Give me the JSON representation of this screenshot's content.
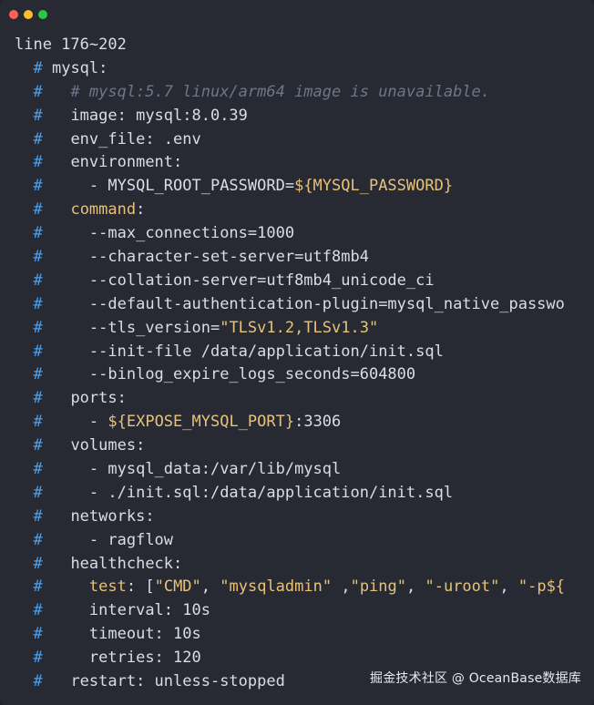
{
  "window": {
    "controls": [
      {
        "name": "close",
        "color": "#ff5f57"
      },
      {
        "name": "minimize",
        "color": "#febc2e"
      },
      {
        "name": "maximize",
        "color": "#28c840"
      }
    ]
  },
  "code": {
    "lines": [
      [
        {
          "t": "line 176~202",
          "c": "plain"
        }
      ],
      [
        {
          "t": "  ",
          "c": "plain"
        },
        {
          "t": "#",
          "c": "hash"
        },
        {
          "t": " mysql:",
          "c": "plain"
        }
      ],
      [
        {
          "t": "  ",
          "c": "plain"
        },
        {
          "t": "#",
          "c": "hash"
        },
        {
          "t": "   # mysql:5.7 linux/arm64 image is unavailable.",
          "c": "comment"
        }
      ],
      [
        {
          "t": "  ",
          "c": "plain"
        },
        {
          "t": "#",
          "c": "hash"
        },
        {
          "t": "   image: mysql:8.0.39",
          "c": "plain"
        }
      ],
      [
        {
          "t": "  ",
          "c": "plain"
        },
        {
          "t": "#",
          "c": "hash"
        },
        {
          "t": "   env_file: .env",
          "c": "plain"
        }
      ],
      [
        {
          "t": "  ",
          "c": "plain"
        },
        {
          "t": "#",
          "c": "hash"
        },
        {
          "t": "   environment:",
          "c": "plain"
        }
      ],
      [
        {
          "t": "  ",
          "c": "plain"
        },
        {
          "t": "#",
          "c": "hash"
        },
        {
          "t": "     - MYSQL_ROOT_PASSWORD=",
          "c": "plain"
        },
        {
          "t": "${MYSQL_PASSWORD}",
          "c": "str"
        }
      ],
      [
        {
          "t": "  ",
          "c": "plain"
        },
        {
          "t": "#",
          "c": "hash"
        },
        {
          "t": "   ",
          "c": "plain"
        },
        {
          "t": "command",
          "c": "key"
        },
        {
          "t": ":",
          "c": "plain"
        }
      ],
      [
        {
          "t": "  ",
          "c": "plain"
        },
        {
          "t": "#",
          "c": "hash"
        },
        {
          "t": "     --max_connections=1000",
          "c": "plain"
        }
      ],
      [
        {
          "t": "  ",
          "c": "plain"
        },
        {
          "t": "#",
          "c": "hash"
        },
        {
          "t": "     --character-set-server=utf8mb4",
          "c": "plain"
        }
      ],
      [
        {
          "t": "  ",
          "c": "plain"
        },
        {
          "t": "#",
          "c": "hash"
        },
        {
          "t": "     --collation-server=utf8mb4_unicode_ci",
          "c": "plain"
        }
      ],
      [
        {
          "t": "  ",
          "c": "plain"
        },
        {
          "t": "#",
          "c": "hash"
        },
        {
          "t": "     --default-authentication-plugin=mysql_native_passwo",
          "c": "plain"
        }
      ],
      [
        {
          "t": "  ",
          "c": "plain"
        },
        {
          "t": "#",
          "c": "hash"
        },
        {
          "t": "     --tls_version=",
          "c": "plain"
        },
        {
          "t": "\"TLSv1.2,TLSv1.3\"",
          "c": "str"
        }
      ],
      [
        {
          "t": "  ",
          "c": "plain"
        },
        {
          "t": "#",
          "c": "hash"
        },
        {
          "t": "     --init-file /data/application/init.sql",
          "c": "plain"
        }
      ],
      [
        {
          "t": "  ",
          "c": "plain"
        },
        {
          "t": "#",
          "c": "hash"
        },
        {
          "t": "     --binlog_expire_logs_seconds=604800",
          "c": "plain"
        }
      ],
      [
        {
          "t": "  ",
          "c": "plain"
        },
        {
          "t": "#",
          "c": "hash"
        },
        {
          "t": "   ports:",
          "c": "plain"
        }
      ],
      [
        {
          "t": "  ",
          "c": "plain"
        },
        {
          "t": "#",
          "c": "hash"
        },
        {
          "t": "     - ",
          "c": "plain"
        },
        {
          "t": "${EXPOSE_MYSQL_PORT}",
          "c": "str"
        },
        {
          "t": ":3306",
          "c": "plain"
        }
      ],
      [
        {
          "t": "  ",
          "c": "plain"
        },
        {
          "t": "#",
          "c": "hash"
        },
        {
          "t": "   volumes:",
          "c": "plain"
        }
      ],
      [
        {
          "t": "  ",
          "c": "plain"
        },
        {
          "t": "#",
          "c": "hash"
        },
        {
          "t": "     - mysql_data:/var/lib/mysql",
          "c": "plain"
        }
      ],
      [
        {
          "t": "  ",
          "c": "plain"
        },
        {
          "t": "#",
          "c": "hash"
        },
        {
          "t": "     - ./init.sql:/data/application/init.sql",
          "c": "plain"
        }
      ],
      [
        {
          "t": "  ",
          "c": "plain"
        },
        {
          "t": "#",
          "c": "hash"
        },
        {
          "t": "   networks:",
          "c": "plain"
        }
      ],
      [
        {
          "t": "  ",
          "c": "plain"
        },
        {
          "t": "#",
          "c": "hash"
        },
        {
          "t": "     - ragflow",
          "c": "plain"
        }
      ],
      [
        {
          "t": "  ",
          "c": "plain"
        },
        {
          "t": "#",
          "c": "hash"
        },
        {
          "t": "   healthcheck:",
          "c": "plain"
        }
      ],
      [
        {
          "t": "  ",
          "c": "plain"
        },
        {
          "t": "#",
          "c": "hash"
        },
        {
          "t": "     ",
          "c": "plain"
        },
        {
          "t": "test",
          "c": "key"
        },
        {
          "t": ": [",
          "c": "plain"
        },
        {
          "t": "\"CMD\"",
          "c": "str"
        },
        {
          "t": ", ",
          "c": "plain"
        },
        {
          "t": "\"mysqladmin\"",
          "c": "str"
        },
        {
          "t": " ,",
          "c": "plain"
        },
        {
          "t": "\"ping\"",
          "c": "str"
        },
        {
          "t": ", ",
          "c": "plain"
        },
        {
          "t": "\"-uroot\"",
          "c": "str"
        },
        {
          "t": ", ",
          "c": "plain"
        },
        {
          "t": "\"-p${",
          "c": "str"
        }
      ],
      [
        {
          "t": "  ",
          "c": "plain"
        },
        {
          "t": "#",
          "c": "hash"
        },
        {
          "t": "     interval: 10s",
          "c": "plain"
        }
      ],
      [
        {
          "t": "  ",
          "c": "plain"
        },
        {
          "t": "#",
          "c": "hash"
        },
        {
          "t": "     timeout: 10s",
          "c": "plain"
        }
      ],
      [
        {
          "t": "  ",
          "c": "plain"
        },
        {
          "t": "#",
          "c": "hash"
        },
        {
          "t": "     retries: 120",
          "c": "plain"
        }
      ],
      [
        {
          "t": "  ",
          "c": "plain"
        },
        {
          "t": "#",
          "c": "hash"
        },
        {
          "t": "   restart: unless-stopped",
          "c": "plain"
        }
      ]
    ]
  },
  "watermark": "掘金技术社区 @ OceanBase数据库"
}
